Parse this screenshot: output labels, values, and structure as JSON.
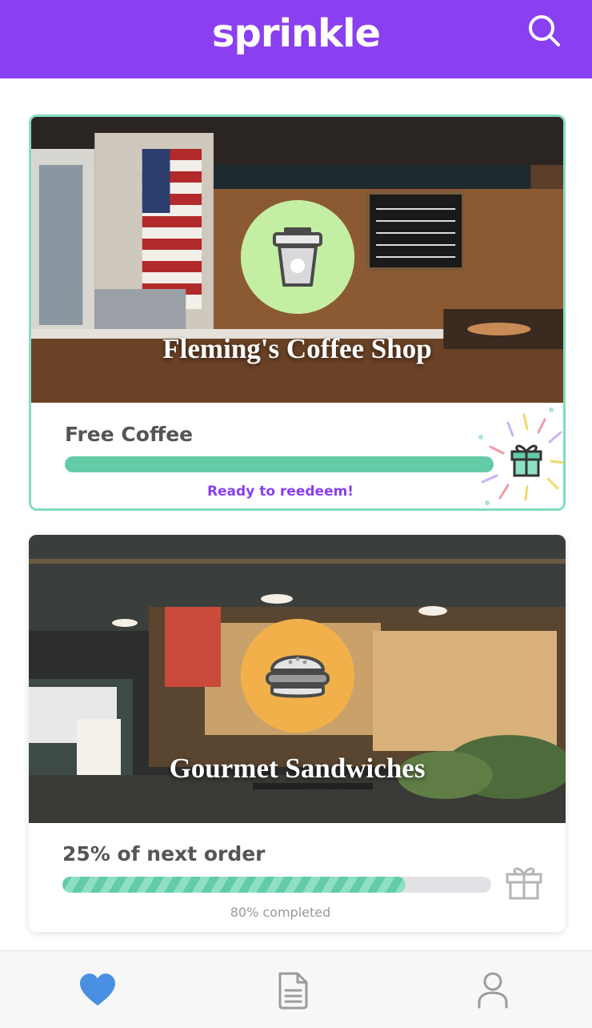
{
  "app": {
    "logo_text": "sprinkle",
    "brand_color": "#8a3ff0"
  },
  "header": {
    "search_icon": "search-icon"
  },
  "cards": [
    {
      "shop_name": "Fleming's Coffee Shop",
      "badge_icon": "coffee-cup-icon",
      "badge_color": "#c4eea2",
      "reward_title": "Free Coffee",
      "progress": 1.0,
      "status_text": "Ready to reedeem!",
      "gift_icon": "gift-celebration-icon"
    },
    {
      "shop_name": "Gourmet Sandwiches",
      "badge_icon": "sandwich-icon",
      "badge_color": "#f1b04a",
      "reward_title": "25% of next order",
      "progress": 0.8,
      "status_text": "80% completed",
      "gift_icon": "gift-outline-icon"
    }
  ],
  "bottom_nav": {
    "items": [
      {
        "icon": "heart-icon",
        "active": true,
        "color": "#4a90e2"
      },
      {
        "icon": "document-icon",
        "active": false,
        "color": "#9b9b9b"
      },
      {
        "icon": "user-icon",
        "active": false,
        "color": "#9b9b9b"
      }
    ]
  }
}
